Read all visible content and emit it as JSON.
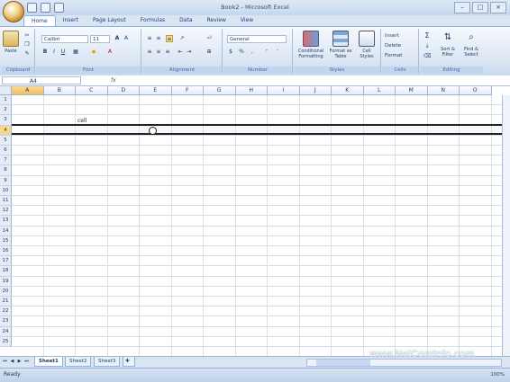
{
  "window": {
    "title": "Book2 - Microsoft Excel",
    "minimize": "–",
    "maximize": "□",
    "close": "×"
  },
  "tabs": [
    "Home",
    "Insert",
    "Page Layout",
    "Formulas",
    "Data",
    "Review",
    "View"
  ],
  "ribbon": {
    "clipboard": {
      "label": "Clipboard",
      "paste": "Paste"
    },
    "font": {
      "label": "Font",
      "name": "Calibri",
      "size": "11",
      "bold": "B",
      "italic": "I",
      "underline": "U"
    },
    "alignment": {
      "label": "Alignment"
    },
    "number": {
      "label": "Number",
      "format": "General",
      "currency": "$",
      "percent": "%"
    },
    "styles": {
      "label": "Styles",
      "conditional": "Conditional Formatting",
      "format_table": "Format as Table",
      "cell_styles": "Cell Styles"
    },
    "cells": {
      "label": "Cells",
      "insert": "Insert",
      "delete": "Delete",
      "format": "Format"
    },
    "editing": {
      "label": "Editing",
      "sort": "Sort & Filter",
      "find": "Find & Select",
      "sigma": "Σ"
    }
  },
  "formula_bar": {
    "name_box": "A4",
    "fx": "fx",
    "value": ""
  },
  "columns": [
    "A",
    "B",
    "C",
    "D",
    "E",
    "F",
    "G",
    "H",
    "I",
    "J",
    "K",
    "L",
    "M",
    "N",
    "O"
  ],
  "rows": [
    "1",
    "2",
    "3",
    "4",
    "5",
    "6",
    "7",
    "8",
    "9",
    "10",
    "11",
    "12",
    "13",
    "14",
    "15",
    "16",
    "17",
    "18",
    "19",
    "20",
    "21",
    "22",
    "23",
    "24",
    "25"
  ],
  "cells": {
    "C3": "cell"
  },
  "selection": {
    "active_cell": "A4",
    "selected_row": "4",
    "selected_column": "A"
  },
  "sheets": [
    "Sheet1",
    "Sheet2",
    "Sheet3"
  ],
  "active_sheet": "Sheet1",
  "status": {
    "ready": "Ready",
    "zoom": "100%"
  },
  "watermark": "www.NetComInfo.com",
  "colors": {
    "selected_header": "#f1c15f",
    "ribbon": "#dbe6f4",
    "accent": "#15428b"
  }
}
